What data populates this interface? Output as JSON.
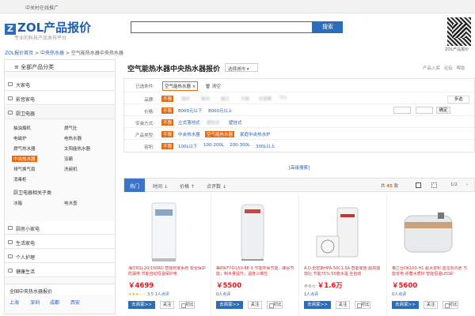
{
  "top": {
    "text": "中关村在线推广"
  },
  "header": {
    "logo_letter": "Z",
    "logo_text": "ZOL产品报价",
    "slogan": "专业的科技产品发布平台",
    "search_placeholder": "",
    "search_button": "搜索",
    "qr_caption": "ZOL产品报价"
  },
  "breadcrumb": {
    "home": "ZOL报价首页",
    "sep1": " > ",
    "level2": "中央热水器",
    "sep2": " > ",
    "current": "空气能热水器中央热水器"
  },
  "sidebar": {
    "all_label": "全部产品分类",
    "categories": [
      {
        "label": "大家电"
      },
      {
        "label": "影音家电"
      },
      {
        "label": "厨卫电器"
      },
      {
        "label": "厨房小家电"
      },
      {
        "label": "生活家电"
      },
      {
        "label": "个人护理"
      },
      {
        "label": "健康生活"
      }
    ],
    "sub_items": [
      "抽油烟机",
      "燃气灶",
      "电磁炉",
      "电热水器",
      "燃气热水器",
      "太阳能热水器",
      "中央热水器",
      "浴霸",
      "排气换气扇",
      "洗碗机",
      "消毒柜"
    ],
    "linked_title": "厨卫电器相关子类",
    "linked": [
      "冰箱",
      "电水壶"
    ],
    "regions_title": "全国中央热水器报价",
    "cities": [
      "上海",
      "深圳",
      "成都",
      "西安"
    ]
  },
  "main": {
    "title": "空气能热水器中央热水器报价",
    "city_select": "选择城市",
    "top_links": "产品入库 论坛 帮助",
    "filters": {
      "selected_label": "已选条件:",
      "selected_chip": "空气能热水器",
      "clear": "清空",
      "brand_label": "品牌:",
      "price_label": "价格:",
      "install_label": "安装方式:",
      "type_label": "产品类型:",
      "capacity_label": "容积:",
      "buxian": "不限",
      "brands": [
        "海尔",
        "美的",
        "格力",
        "万和",
        "史密斯",
        "TCL"
      ],
      "more": "多选",
      "prices": [
        "8000元以下",
        "8000元以上"
      ],
      "confirm": "确定",
      "installs": [
        "立式落地式",
        "壁挂式",
        "壁挂式"
      ],
      "types": [
        "中央热水器",
        "空气能热水器",
        "家庭中央热水炉"
      ],
      "capacities": [
        "100L以下",
        "100-200L",
        "200-300L",
        "300L以上"
      ],
      "advanced": "[高级搜索]"
    },
    "tabs": [
      {
        "label": "热门"
      },
      {
        "label": "时间 ↓"
      },
      {
        "label": "价格 ↑"
      },
      {
        "label": "点评数 ↓"
      }
    ],
    "total_prefix": "共",
    "total_count": "45",
    "total_suffix": "款",
    "page_indicator": "1/2",
    "products": [
      {
        "name": "海尔RSJ-20/150RD 智能管家系统 安全保护防漏电 节能自动恒温保护电",
        "price": "￥4699",
        "rating": "3.5",
        "reviews": "1人点评",
        "stars": "★★★☆☆"
      },
      {
        "name": "美的KF70/150-BE 3 节能环保节能、峰谷节能，制水量提升，温度三维控",
        "price": "￥5500",
        "rating": "",
        "reviews": "0人点评",
        "stars": ""
      },
      {
        "name": "A.O.史密斯HPA-50C1.5A 智能家居 超高能效比 节能75% 55度水温 全自动",
        "price": "￥1.6万",
        "ref_label": "参考价:",
        "rating": "",
        "reviews": "1人点评",
        "stars": ""
      },
      {
        "name": "格兰仕DK100-H1 超大容积 蓝宝石内胆 节能省电 杀菌水质好 智能恒温LED彩",
        "price": "￥5600",
        "rating": "",
        "reviews": "0人点评",
        "stars": ""
      }
    ],
    "buttons": {
      "buy": "去商家>>",
      "fav": "关注",
      "compare": "对比"
    }
  }
}
